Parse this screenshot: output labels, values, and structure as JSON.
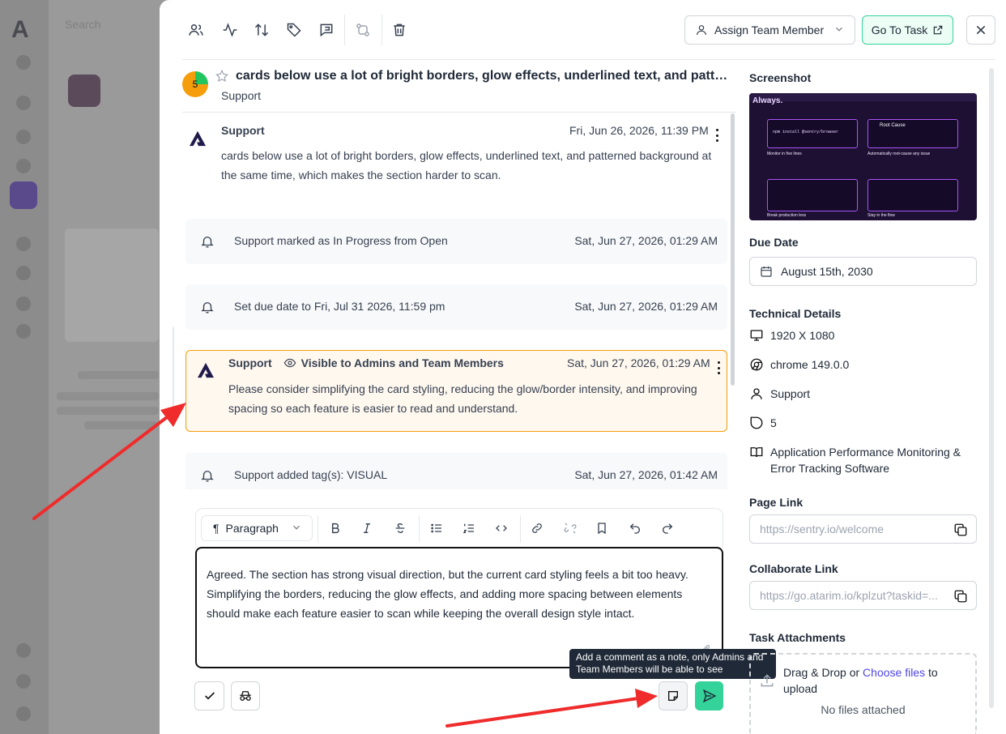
{
  "background": {
    "search_placeholder": "Search"
  },
  "toolbar": {
    "assign_label": "Assign Team Member",
    "goto_label": "Go To Task"
  },
  "task": {
    "score": "5",
    "title": "cards below use a lot of bright borders, glow effects, underlined text, and patterned background at the same time, which makes the section harder to scan.",
    "subtitle": "Support"
  },
  "feed": {
    "first_message": {
      "author": "Support",
      "date": "Fri, Jun 26, 2026, 11:39 PM",
      "body": "cards below use a lot of bright borders, glow effects, underlined text, and patterned background at the same time, which makes the section harder to scan."
    },
    "events": [
      {
        "text": "Support marked as In Progress from Open",
        "date": "Sat, Jun 27, 2026, 01:29 AM"
      },
      {
        "text": "Set due date to Fri, Jul 31 2026, 11:59 pm",
        "date": "Sat, Jun 27, 2026, 01:29 AM"
      },
      {
        "text": "Support added tag(s): VISUAL",
        "date": "Sat, Jun 27, 2026, 01:42 AM"
      }
    ],
    "note": {
      "author": "Support",
      "visibility": "Visible to Admins and Team Members",
      "date": "Sat, Jun 27, 2026, 01:29 AM",
      "body": "Please consider simplifying the card styling, reducing the glow/border intensity, and improving spacing so each feature is easier to read and understand."
    }
  },
  "editor": {
    "paragraph_label": "Paragraph",
    "content": "Agreed. The section has strong visual direction, but the current card styling feels a bit too heavy. Simplifying the borders, reducing the glow effects, and adding more spacing between elements should make each feature easier to scan while keeping the overall design style intact.",
    "tooltip": "Add a comment as a note, only Admins and Team Members will be able to see"
  },
  "sidebar": {
    "screenshot_label": "Screenshot",
    "due_date_label": "Due Date",
    "due_date_value": "August 15th, 2030",
    "technical_label": "Technical Details",
    "resolution": "1920 X 1080",
    "browser": "chrome 149.0.0",
    "user": "Support",
    "score": "5",
    "category": "Application Performance Monitoring & Error Tracking Software",
    "page_link_label": "Page Link",
    "page_link": "https://sentry.io/welcome",
    "collab_link_label": "Collaborate Link",
    "collab_link": "https://go.atarim.io/kplzut?taskid=...",
    "attachments_label": "Task Attachments",
    "drop_prefix": "Drag & Drop or ",
    "drop_link": "Choose files",
    "drop_suffix": " to upload",
    "no_files": "No files attached"
  },
  "screenshot_thumb": {
    "heading": "Always.",
    "code": "npm install @sentry/browser",
    "root_cause": "Root Cause",
    "monitor": "Monitor in five lines",
    "automatic": "Automatically root-cause any issue",
    "break_text": "Break production less",
    "stay": "Stay in the flow"
  },
  "colors": {
    "accent_green": "#34d399",
    "note_border": "#f59e0b",
    "note_bg": "#fff8ef",
    "link_purple": "#4f46e5",
    "arrow_red": "#ef2b2b"
  }
}
